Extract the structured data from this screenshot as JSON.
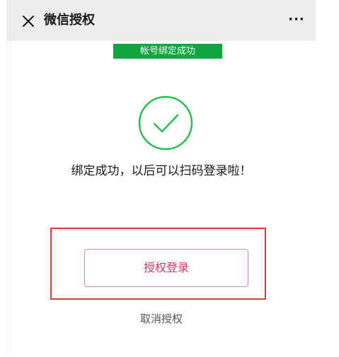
{
  "navbar": {
    "title": "微信授权",
    "close_icon": "close-icon",
    "more_label": "···"
  },
  "banner": {
    "text": "帐号绑定成功",
    "color": "#0ea63e"
  },
  "main": {
    "status_icon": "check-circle-icon",
    "status_color": "#2bbd4f",
    "message": "绑定成功，以后可以扫码登录啦！",
    "auth_button_label": "授权登录",
    "auth_button_color": "#e0335e",
    "cancel_label": "取消授权",
    "highlight_color": "#e53935"
  }
}
